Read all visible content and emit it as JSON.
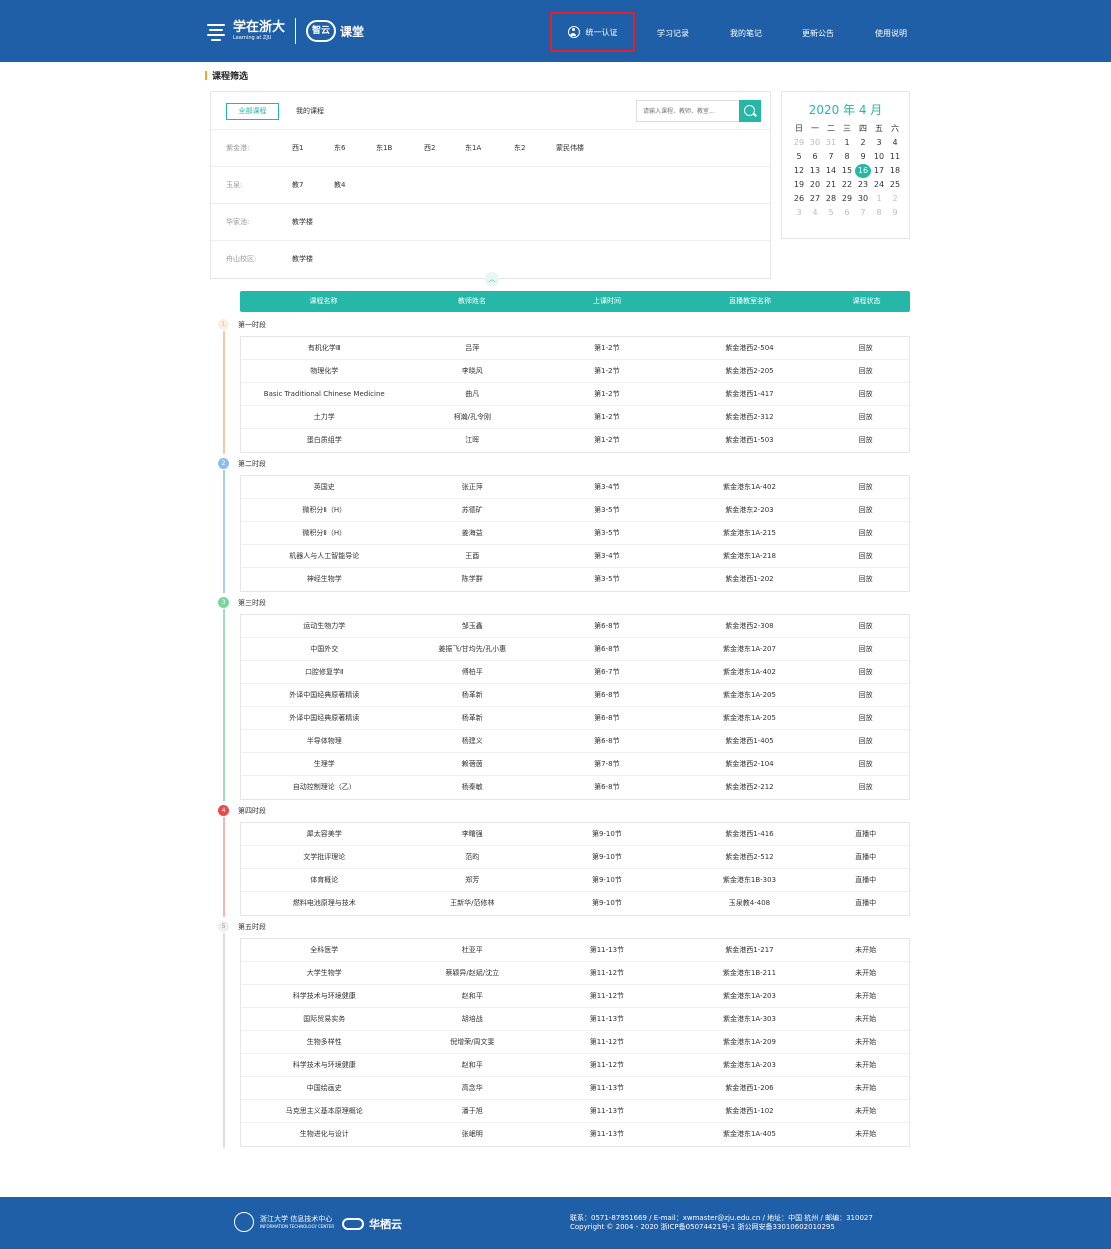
{
  "header": {
    "logo_cn": "学在浙大",
    "logo_en": "Learning at ZJU",
    "cloud_badge": "智云",
    "cloud_name": "课堂",
    "auth_label": "统一认证",
    "nav": [
      "学习记录",
      "我的笔记",
      "更新公告",
      "使用说明"
    ]
  },
  "section_title": "课程筛选",
  "filter": {
    "tab_all": "全部课程",
    "tab_mine": "我的课程",
    "search_placeholder": "请输入课程、教师、教室...",
    "campuses": [
      {
        "label": "紫金港:",
        "buildings": [
          "西1",
          "东6",
          "东1B",
          "西2",
          "东1A",
          "东2",
          "蒙民伟楼"
        ]
      },
      {
        "label": "玉泉:",
        "buildings": [
          "教7",
          "教4"
        ]
      },
      {
        "label": "华家池:",
        "buildings": [
          "教学楼"
        ]
      },
      {
        "label": "舟山校区:",
        "buildings": [
          "教学楼"
        ]
      }
    ]
  },
  "calendar": {
    "title": "2020 年 4 月",
    "weekdays": [
      "日",
      "一",
      "二",
      "三",
      "四",
      "五",
      "六"
    ],
    "today": "16",
    "weeks": [
      [
        [
          "29",
          1
        ],
        [
          "30",
          1
        ],
        [
          "31",
          1
        ],
        [
          "1",
          0
        ],
        [
          "2",
          0
        ],
        [
          "3",
          0
        ],
        [
          "4",
          0
        ]
      ],
      [
        [
          "5",
          0
        ],
        [
          "6",
          0
        ],
        [
          "7",
          0
        ],
        [
          "8",
          0
        ],
        [
          "9",
          0
        ],
        [
          "10",
          0
        ],
        [
          "11",
          0
        ]
      ],
      [
        [
          "12",
          0
        ],
        [
          "13",
          0
        ],
        [
          "14",
          0
        ],
        [
          "15",
          0
        ],
        [
          "16",
          0
        ],
        [
          "17",
          0
        ],
        [
          "18",
          0
        ]
      ],
      [
        [
          "19",
          0
        ],
        [
          "20",
          0
        ],
        [
          "21",
          0
        ],
        [
          "22",
          0
        ],
        [
          "23",
          0
        ],
        [
          "24",
          0
        ],
        [
          "25",
          0
        ]
      ],
      [
        [
          "26",
          0
        ],
        [
          "27",
          0
        ],
        [
          "28",
          0
        ],
        [
          "29",
          0
        ],
        [
          "30",
          0
        ],
        [
          "1",
          1
        ],
        [
          "2",
          1
        ]
      ],
      [
        [
          "3",
          1
        ],
        [
          "4",
          1
        ],
        [
          "5",
          1
        ],
        [
          "6",
          1
        ],
        [
          "7",
          1
        ],
        [
          "8",
          1
        ],
        [
          "9",
          1
        ]
      ]
    ]
  },
  "table_headers": [
    "课程名称",
    "教师姓名",
    "上课时间",
    "直播教室名称",
    "课程状态"
  ],
  "periods": [
    {
      "num": "1",
      "label": "第一时段",
      "color": "#f5c9a8",
      "num_color": "#f0b08a",
      "num_bg": "#fdeee3",
      "rows": [
        [
          "有机化学Ⅲ",
          "吕萍",
          "第1-2节",
          "紫金港西2-504",
          "回放"
        ],
        [
          "物理化学",
          "李晓风",
          "第1-2节",
          "紫金港西2-205",
          "回放"
        ],
        [
          "Basic Traditional Chinese Medicine",
          "曲凡",
          "第1-2节",
          "紫金港西1-417",
          "回放"
        ],
        [
          "土力学",
          "柯瀚/孔令刚",
          "第1-2节",
          "紫金港西2-312",
          "回放"
        ],
        [
          "蛋白质组学",
          "江晖",
          "第1-2节",
          "紫金港西1-503",
          "回放"
        ]
      ]
    },
    {
      "num": "2",
      "label": "第二时段",
      "color": "#a9cdf2",
      "num_color": "#ffffff",
      "num_bg": "#8cbdf0",
      "rows": [
        [
          "英国史",
          "张正萍",
          "第3-4节",
          "紫金港东1A-402",
          "回放"
        ],
        [
          "微积分Ⅱ（H）",
          "苏德矿",
          "第3-5节",
          "紫金港东2-203",
          "回放"
        ],
        [
          "微积分Ⅱ（H）",
          "姜海益",
          "第3-5节",
          "紫金港东1A-215",
          "回放"
        ],
        [
          "机器人与人工智能导论",
          "王酉",
          "第3-4节",
          "紫金港东1A-218",
          "回放"
        ],
        [
          "神经生物学",
          "陈学群",
          "第3-5节",
          "紫金港西1-202",
          "回放"
        ]
      ]
    },
    {
      "num": "3",
      "label": "第三时段",
      "color": "#9fe0b8",
      "num_color": "#ffffff",
      "num_bg": "#7bd49e",
      "rows": [
        [
          "运动生物力学",
          "邹玉鑫",
          "第6-8节",
          "紫金港西2-308",
          "回放"
        ],
        [
          "中国外交",
          "姜振飞/甘均先/孔小惠",
          "第6-8节",
          "紫金港东1A-207",
          "回放"
        ],
        [
          "口腔修复学Ⅱ",
          "傅柏平",
          "第6-7节",
          "紫金港东1A-402",
          "回放"
        ],
        [
          "外译中国经典原著精读",
          "杨革新",
          "第6-8节",
          "紫金港东1A-205",
          "回放"
        ],
        [
          "外译中国经典原著精读",
          "杨革新",
          "第6-8节",
          "紫金港东1A-205",
          "回放"
        ],
        [
          "半导体物理",
          "杨建义",
          "第6-8节",
          "紫金港西1-405",
          "回放"
        ],
        [
          "生理学",
          "赖蓓茵",
          "第7-8节",
          "紫金港西2-104",
          "回放"
        ],
        [
          "自动控制理论（乙）",
          "杨秦敏",
          "第6-8节",
          "紫金港西2-212",
          "回放"
        ]
      ]
    },
    {
      "num": "4",
      "label": "第四时段",
      "color": "#f5b5b5",
      "num_color": "#ffffff",
      "num_bg": "#e84b4b",
      "rows": [
        [
          "犀太容美学",
          "李曙强",
          "第9-10节",
          "紫金港西1-416",
          "直播中"
        ],
        [
          "文学批评理论",
          "范昀",
          "第9-10节",
          "紫金港西2-512",
          "直播中"
        ],
        [
          "体育概论",
          "郑芳",
          "第9-10节",
          "紫金港东1B-303",
          "直播中"
        ],
        [
          "燃料电池原理与技术",
          "王新华/范修林",
          "第9-10节",
          "玉泉教4-408",
          "直播中"
        ]
      ]
    },
    {
      "num": "5",
      "label": "第五时段",
      "color": "#dddddd",
      "num_color": "#999999",
      "num_bg": "#eeeeee",
      "rows": [
        [
          "全科医学",
          "杜亚平",
          "第11-13节",
          "紫金港西1-217",
          "未开始"
        ],
        [
          "大学生物学",
          "蔡颖异/赵斌/沈立",
          "第11-12节",
          "紫金港东1B-211",
          "未开始"
        ],
        [
          "科学技术与环境健康",
          "赵和平",
          "第11-12节",
          "紫金港东1A-203",
          "未开始"
        ],
        [
          "国际贸易实务",
          "胡培战",
          "第11-13节",
          "紫金港东1A-303",
          "未开始"
        ],
        [
          "生物多样性",
          "倪增荣/周文斐",
          "第11-12节",
          "紫金港东1A-209",
          "未开始"
        ],
        [
          "科学技术与环境健康",
          "赵和平",
          "第11-12节",
          "紫金港东1A-203",
          "未开始"
        ],
        [
          "中国绘画史",
          "高念华",
          "第11-13节",
          "紫金港西1-206",
          "未开始"
        ],
        [
          "马克思主义基本原理概论",
          "潘于旭",
          "第11-13节",
          "紫金港西1-102",
          "未开始"
        ],
        [
          "生物进化与设计",
          "张岷明",
          "第11-13节",
          "紫金港东1A-405",
          "未开始"
        ]
      ]
    }
  ],
  "footer": {
    "zju_name": "浙江大学 信息技术中心",
    "zju_en": "INFORMATION TECHNOLOGY CENTER",
    "cloud_brand": "华栖云",
    "contact": "联系：0571-87951669 / E-mail：xwmaster@zju.edu.cn / 地址：中国 杭州 / 邮编：310027",
    "copyright": "Copyright © 2004 - 2020 浙ICP备05074421号-1 浙公网安备33010602010295"
  }
}
